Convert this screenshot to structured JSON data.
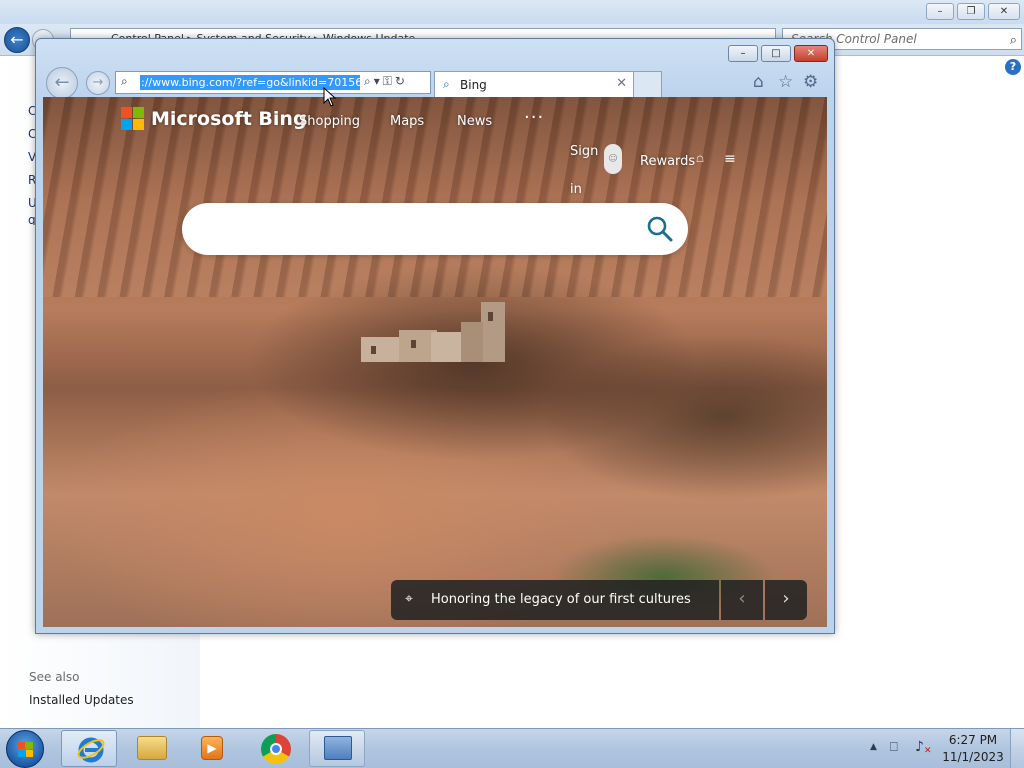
{
  "control_panel": {
    "address_text": "Control Panel ▸ System and Security ▸ Windows Update",
    "search_placeholder": "Search Control Panel",
    "nav_initials": [
      "C",
      "C",
      "V",
      "R",
      "U",
      "q"
    ],
    "see_also": "See also",
    "installed_updates": "Installed Updates",
    "titlebar_controls": {
      "minimize": "–",
      "maximize": "❐",
      "close": "✕"
    }
  },
  "ie": {
    "url": "://www.bing.com/?ref=go&linkid=70156",
    "address_tools": "⌕▾⚿↻",
    "tab_title": "Bing",
    "tab_close": "✕",
    "titlebar_controls": {
      "minimize": "–",
      "maximize": "□",
      "close": "✕"
    },
    "back_glyph": "←",
    "forward_glyph": "→",
    "command_icons": [
      "home-icon",
      "favorites-star-icon",
      "tools-gear-icon"
    ]
  },
  "bing": {
    "logo_text": "Microsoft Bing",
    "nav": [
      "Shopping",
      "Maps",
      "News"
    ],
    "more": "···",
    "sign_in": "Sign in",
    "rewards": "Rewards",
    "search_value": "",
    "caption": "Honoring the legacy of our first cultures",
    "prev_glyph": "‹",
    "next_glyph": "›",
    "colors": {
      "ms_red": "#f25022",
      "ms_green": "#7fba00",
      "ms_blue": "#00a4ef",
      "ms_yellow": "#ffb900",
      "search_icon": "#1a6e8e"
    }
  },
  "taskbar": {
    "pinned": [
      "internet-explorer",
      "windows-explorer",
      "windows-media-player",
      "google-chrome",
      "control-panel"
    ],
    "time": "6:27 PM",
    "date": "11/1/2023"
  }
}
